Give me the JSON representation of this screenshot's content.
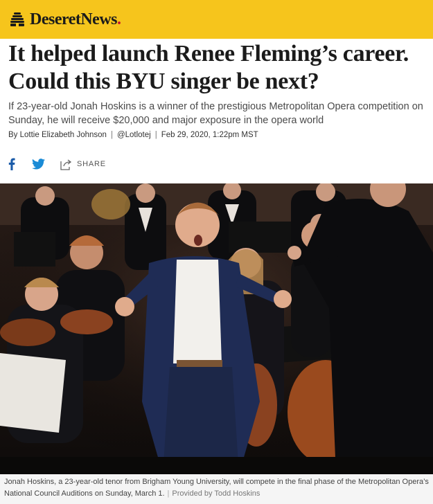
{
  "header": {
    "logo_text": "DeseretNews",
    "logo_dot": ".",
    "logo_icon": "beehive-icon",
    "brand_color": "#f6c51c",
    "accent_color": "#c8102e"
  },
  "article": {
    "headline": "It helped launch Renee Fleming’s career. Could this BYU singer be next?",
    "dek": "If 23-year-old Jonah Hoskins is a winner of the prestigious Metropolitan Opera competition on Sunday, he will receive $20,000 and major exposure in the opera world",
    "byline": {
      "prefix": "By",
      "author": "Lottie Elizabeth Johnson",
      "handle": "@Lotlotej",
      "date": "Feb 29, 2020, 1:22pm MST"
    }
  },
  "share": {
    "facebook_icon": "facebook-icon",
    "twitter_icon": "twitter-icon",
    "share_icon": "share-icon",
    "share_label": "SHARE"
  },
  "photo": {
    "caption": "Jonah Hoskins, a 23-year-old tenor from Brigham Young University, will compete in the final phase of the Metropolitan Opera’s National Council Auditions on Sunday, March 1.",
    "credit": "Provided by Todd Hoskins"
  }
}
